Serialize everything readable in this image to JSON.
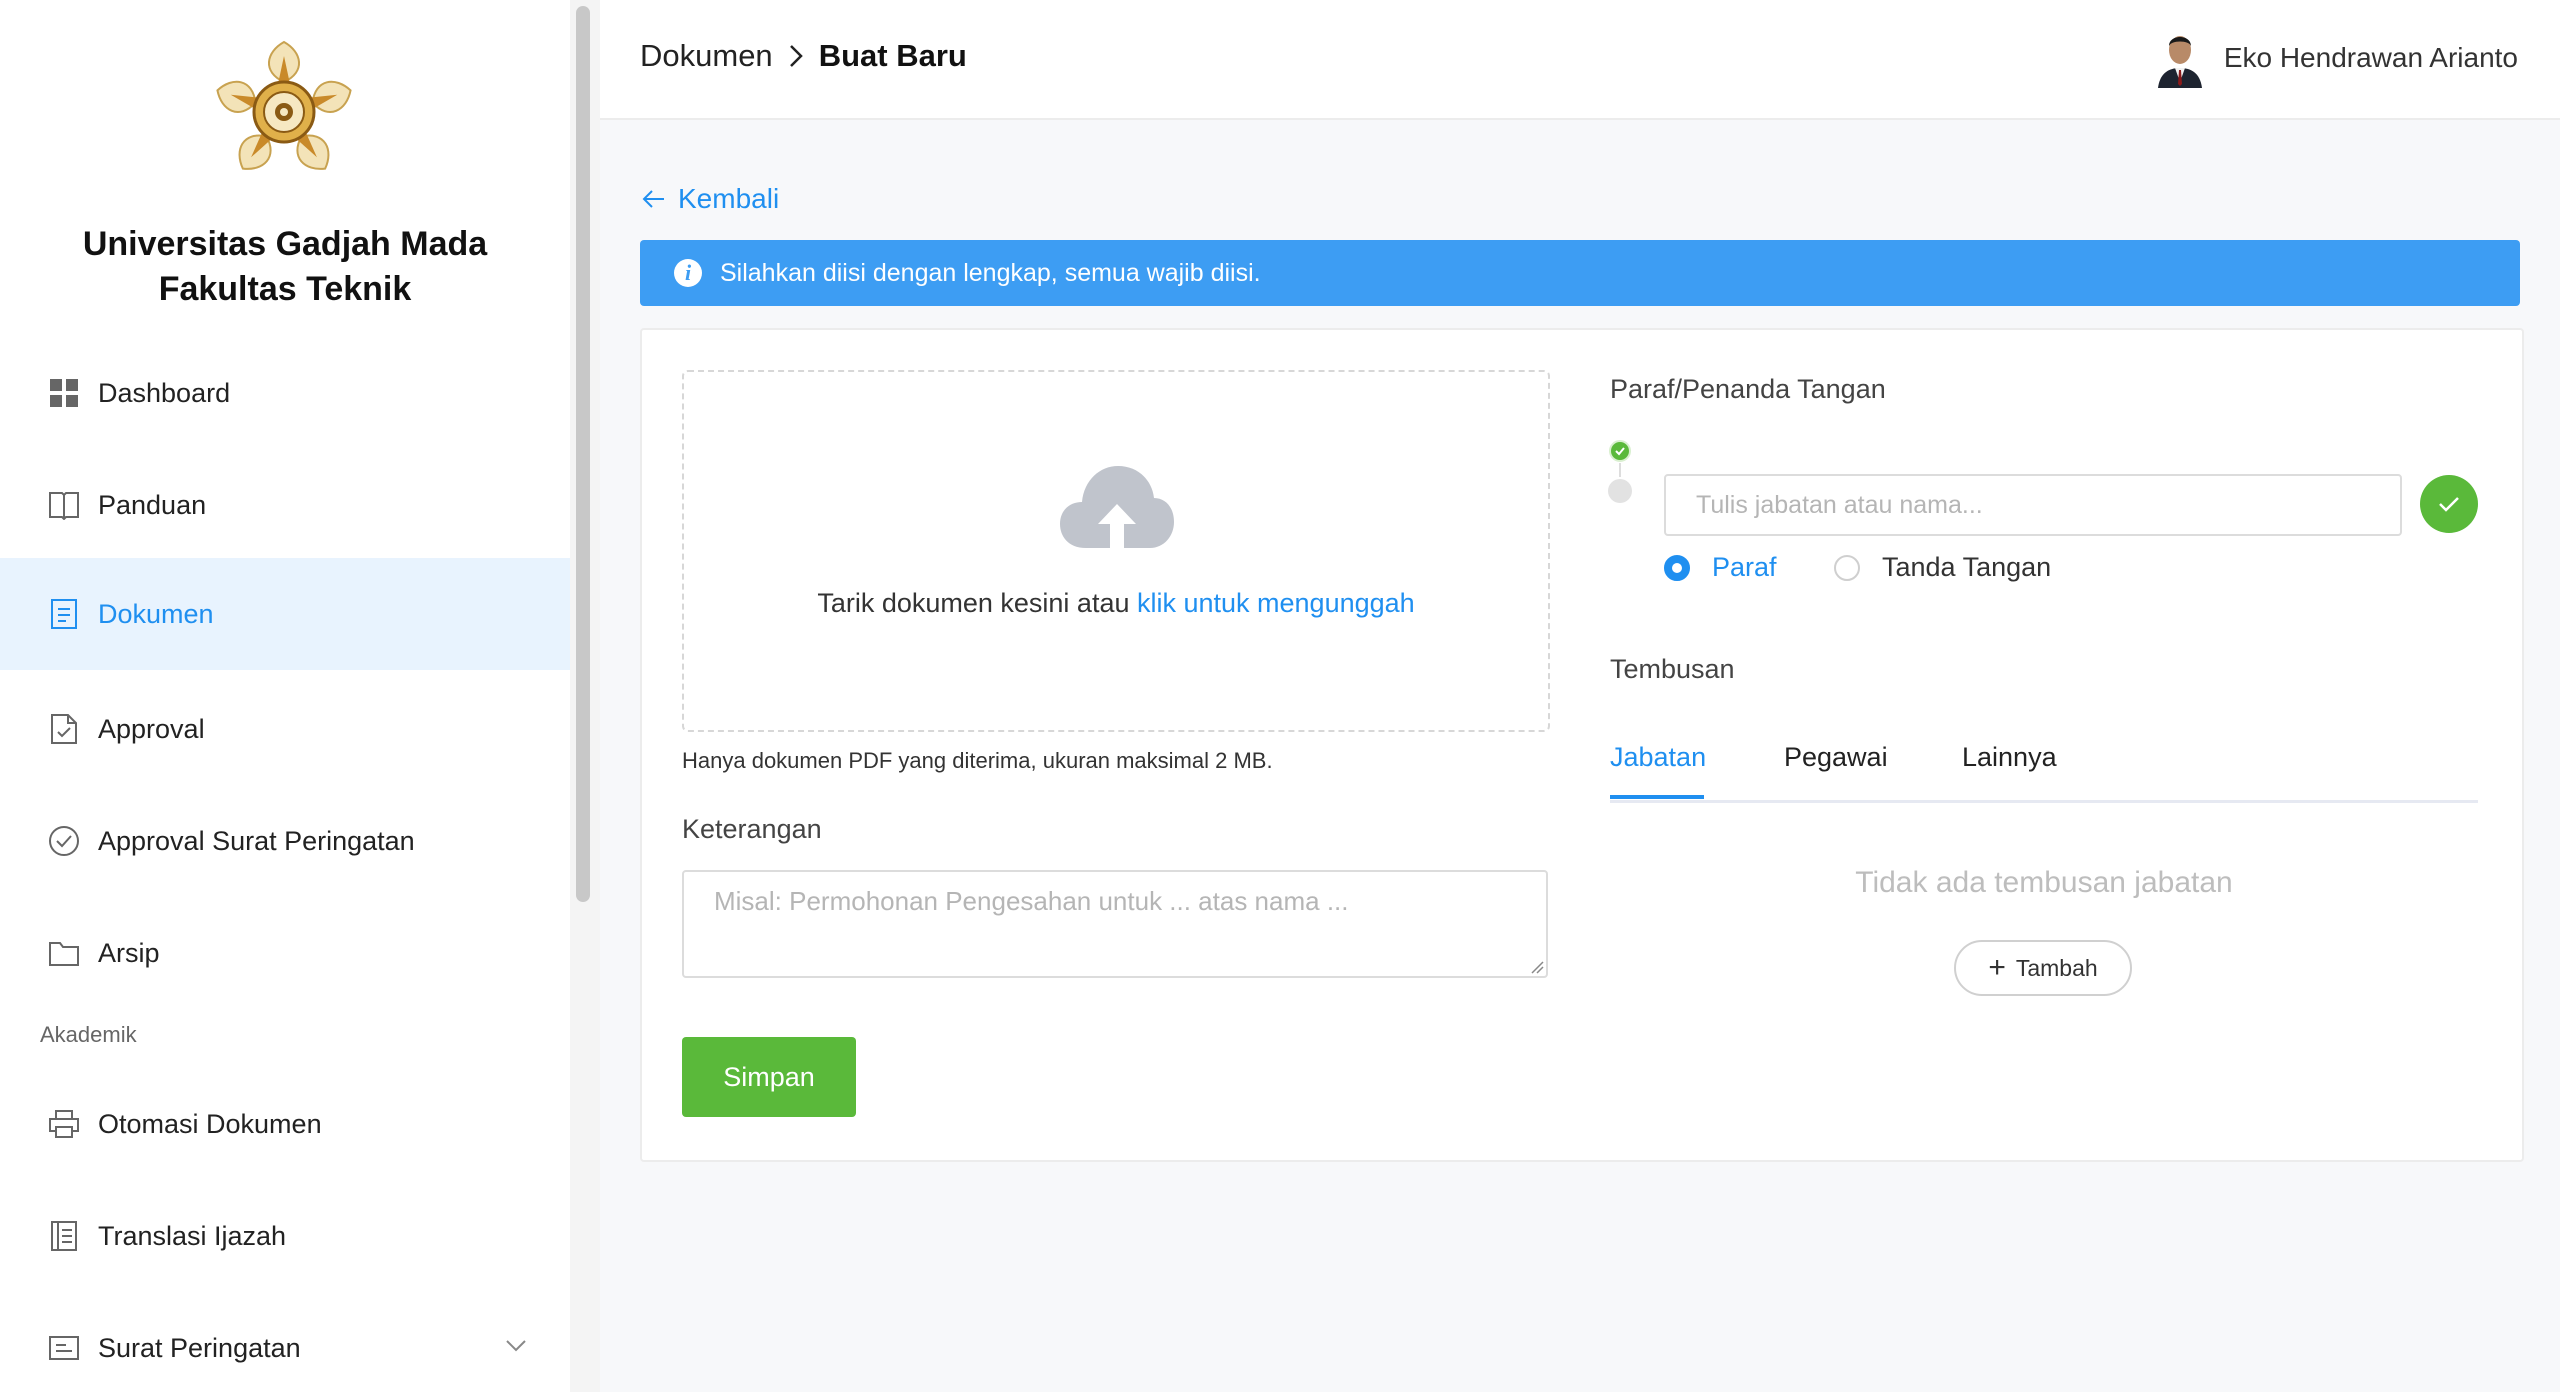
{
  "sidebar": {
    "brand_line1": "Universitas Gadjah Mada",
    "brand_line2": "Fakultas Teknik",
    "items": [
      {
        "label": "Dashboard",
        "icon": "dashboard-icon"
      },
      {
        "label": "Panduan",
        "icon": "book-icon"
      },
      {
        "label": "Dokumen",
        "icon": "document-icon",
        "active": true
      },
      {
        "label": "Approval",
        "icon": "file-check-icon"
      },
      {
        "label": "Approval Surat Peringatan",
        "icon": "check-circle-icon"
      },
      {
        "label": "Arsip",
        "icon": "folder-icon"
      }
    ],
    "section_label": "Akademik",
    "academic_items": [
      {
        "label": "Otomasi Dokumen",
        "icon": "printer-icon"
      },
      {
        "label": "Translasi Ijazah",
        "icon": "ledger-icon"
      },
      {
        "label": "Surat Peringatan",
        "icon": "message-icon",
        "has_chevron": true
      }
    ]
  },
  "header": {
    "breadcrumb_parent": "Dokumen",
    "breadcrumb_current": "Buat Baru",
    "user_name": "Eko Hendrawan Arianto"
  },
  "main": {
    "back_label": "Kembali",
    "alert_text": "Silahkan diisi dengan lengkap, semua wajib diisi.",
    "upload": {
      "text_prefix": "Tarik dokumen kesini atau ",
      "text_link": "klik untuk mengunggah",
      "hint": "Hanya dokumen PDF yang diterima, ukuran maksimal 2 MB."
    },
    "keterangan": {
      "label": "Keterangan",
      "placeholder": "Misal: Permohonan Pengesahan untuk ... atas nama ...",
      "value": ""
    },
    "save_label": "Simpan",
    "signer": {
      "title": "Paraf/Penanda Tangan",
      "placeholder": "Tulis jabatan atau nama...",
      "value": "",
      "radio_paraf": "Paraf",
      "radio_tanda_tangan": "Tanda Tangan",
      "selected": "Paraf"
    },
    "tembusan": {
      "title": "Tembusan",
      "tabs": [
        "Jabatan",
        "Pegawai",
        "Lainnya"
      ],
      "active_tab": "Jabatan",
      "empty_text": "Tidak ada tembusan jabatan",
      "add_label": "Tambah"
    }
  },
  "colors": {
    "accent": "#1f8ff0",
    "alert_bg": "#3d9df3",
    "success": "#5ab93a",
    "active_nav_bg": "#e8f3fe"
  }
}
